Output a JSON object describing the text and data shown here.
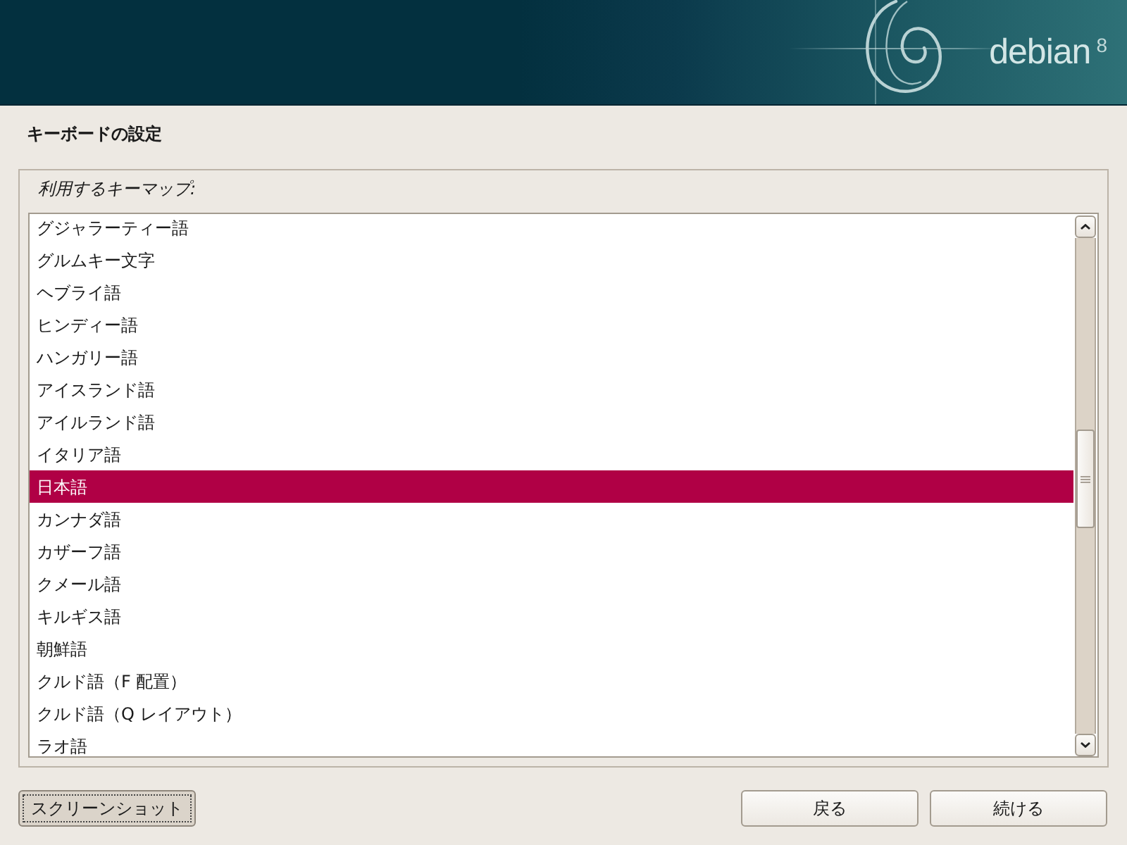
{
  "banner": {
    "logo_text": "debian",
    "version": "8"
  },
  "page_title": "キーボードの設定",
  "keymap_frame": {
    "label": "利用するキーマップ:",
    "items": [
      {
        "label": "グジャラーティー語",
        "selected": false
      },
      {
        "label": "グルムキー文字",
        "selected": false
      },
      {
        "label": "ヘブライ語",
        "selected": false
      },
      {
        "label": "ヒンディー語",
        "selected": false
      },
      {
        "label": "ハンガリー語",
        "selected": false
      },
      {
        "label": "アイスランド語",
        "selected": false
      },
      {
        "label": "アイルランド語",
        "selected": false
      },
      {
        "label": "イタリア語",
        "selected": false
      },
      {
        "label": "日本語",
        "selected": true
      },
      {
        "label": "カンナダ語",
        "selected": false
      },
      {
        "label": "カザーフ語",
        "selected": false
      },
      {
        "label": "クメール語",
        "selected": false
      },
      {
        "label": "キルギス語",
        "selected": false
      },
      {
        "label": "朝鮮語",
        "selected": false
      },
      {
        "label": "クルド語（F 配置）",
        "selected": false
      },
      {
        "label": "クルド語（Q レイアウト）",
        "selected": false
      },
      {
        "label": "ラオ語",
        "selected": false
      }
    ]
  },
  "footer": {
    "left_buttons": [
      {
        "label": "スクリーンショット",
        "focused": true
      }
    ],
    "right_buttons": [
      {
        "label": "戻る",
        "focused": false
      },
      {
        "label": "続ける",
        "focused": false
      }
    ]
  }
}
